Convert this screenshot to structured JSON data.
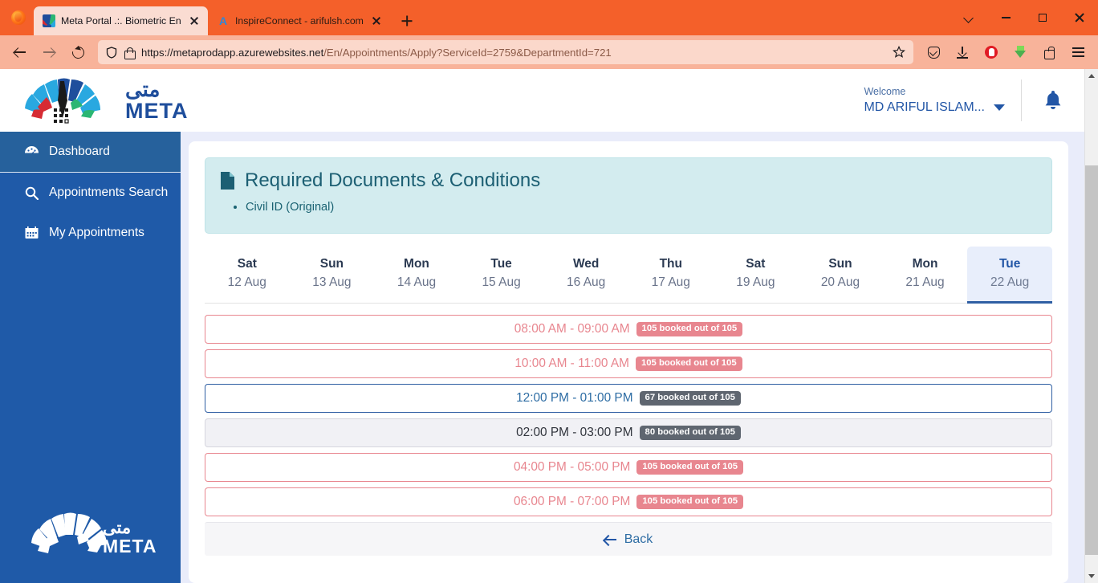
{
  "browser": {
    "tabs": [
      {
        "title": "Meta Portal .:. Biometric Enrollm",
        "favicon": "meta-favicon",
        "active": true
      },
      {
        "title": "InspireConnect - arifulsh.com",
        "favicon": "letter-a-favicon",
        "active": false
      }
    ],
    "new_tab_label": "+",
    "url": "https://metaprodapp.azurewebsites.net/En/Appointments/Apply?ServiceId=2759&DepartmentId=721",
    "url_host": "https://metaprodapp.azurewebsites.net",
    "url_path": "/En/Appointments/Apply?ServiceId=2759&DepartmentId=721",
    "toolbar_icons": [
      "pocket-icon",
      "downloads-icon",
      "adblock-icon",
      "download-helper-icon",
      "extensions-icon",
      "menu-icon"
    ],
    "window_controls": [
      "list-all-tabs-icon",
      "minimize-icon",
      "maximize-icon",
      "close-icon"
    ]
  },
  "header": {
    "logo_alt": "META",
    "logo_arabic": "متى",
    "logo_latin": "META",
    "welcome_label": "Welcome",
    "welcome_user": "MD ARIFUL ISLAM...",
    "bell_icon": "notification-bell-icon"
  },
  "sidebar": {
    "items": [
      {
        "label": "Dashboard",
        "icon": "dashboard-icon",
        "active": true
      },
      {
        "label": "Appointments Search",
        "icon": "search-icon",
        "active": false
      },
      {
        "label": "My Appointments",
        "icon": "calendar-icon",
        "active": false
      }
    ],
    "footer_logo_alt": "META"
  },
  "documents_panel": {
    "icon": "document-icon",
    "title": "Required Documents & Conditions",
    "items": [
      "Civil ID (Original)"
    ]
  },
  "date_tabs": [
    {
      "dow": "Sat",
      "dom": "12 Aug",
      "active": false
    },
    {
      "dow": "Sun",
      "dom": "13 Aug",
      "active": false
    },
    {
      "dow": "Mon",
      "dom": "14 Aug",
      "active": false
    },
    {
      "dow": "Tue",
      "dom": "15 Aug",
      "active": false
    },
    {
      "dow": "Wed",
      "dom": "16 Aug",
      "active": false
    },
    {
      "dow": "Thu",
      "dom": "17 Aug",
      "active": false
    },
    {
      "dow": "Sat",
      "dom": "19 Aug",
      "active": false
    },
    {
      "dow": "Sun",
      "dom": "20 Aug",
      "active": false
    },
    {
      "dow": "Mon",
      "dom": "21 Aug",
      "active": false
    },
    {
      "dow": "Tue",
      "dom": "22 Aug",
      "active": true
    }
  ],
  "slots": [
    {
      "time": "08:00 AM - 09:00 AM",
      "badge": "105 booked out of 105",
      "state": "full",
      "booked": 105,
      "capacity": 105
    },
    {
      "time": "10:00 AM - 11:00 AM",
      "badge": "105 booked out of 105",
      "state": "full",
      "booked": 105,
      "capacity": 105
    },
    {
      "time": "12:00 PM - 01:00 PM",
      "badge": "67 booked out of 105",
      "state": "open",
      "booked": 67,
      "capacity": 105
    },
    {
      "time": "02:00 PM - 03:00 PM",
      "badge": "80 booked out of 105",
      "state": "selected",
      "booked": 80,
      "capacity": 105
    },
    {
      "time": "04:00 PM - 05:00 PM",
      "badge": "105 booked out of 105",
      "state": "full",
      "booked": 105,
      "capacity": 105
    },
    {
      "time": "06:00 PM - 07:00 PM",
      "badge": "105 booked out of 105",
      "state": "full",
      "booked": 105,
      "capacity": 105
    }
  ],
  "back_button": {
    "label": "Back",
    "icon": "arrow-left-icon"
  },
  "colors": {
    "brand_blue": "#1f5aa8",
    "accent_blue": "#2256a6",
    "full_red": "#e8868f",
    "badge_grey": "#5f6670",
    "alert_teal_bg": "#d3ecef",
    "alert_teal_text": "#1c5f73",
    "page_bg": "#e9ecfa",
    "browser_orange": "#f4602a"
  }
}
